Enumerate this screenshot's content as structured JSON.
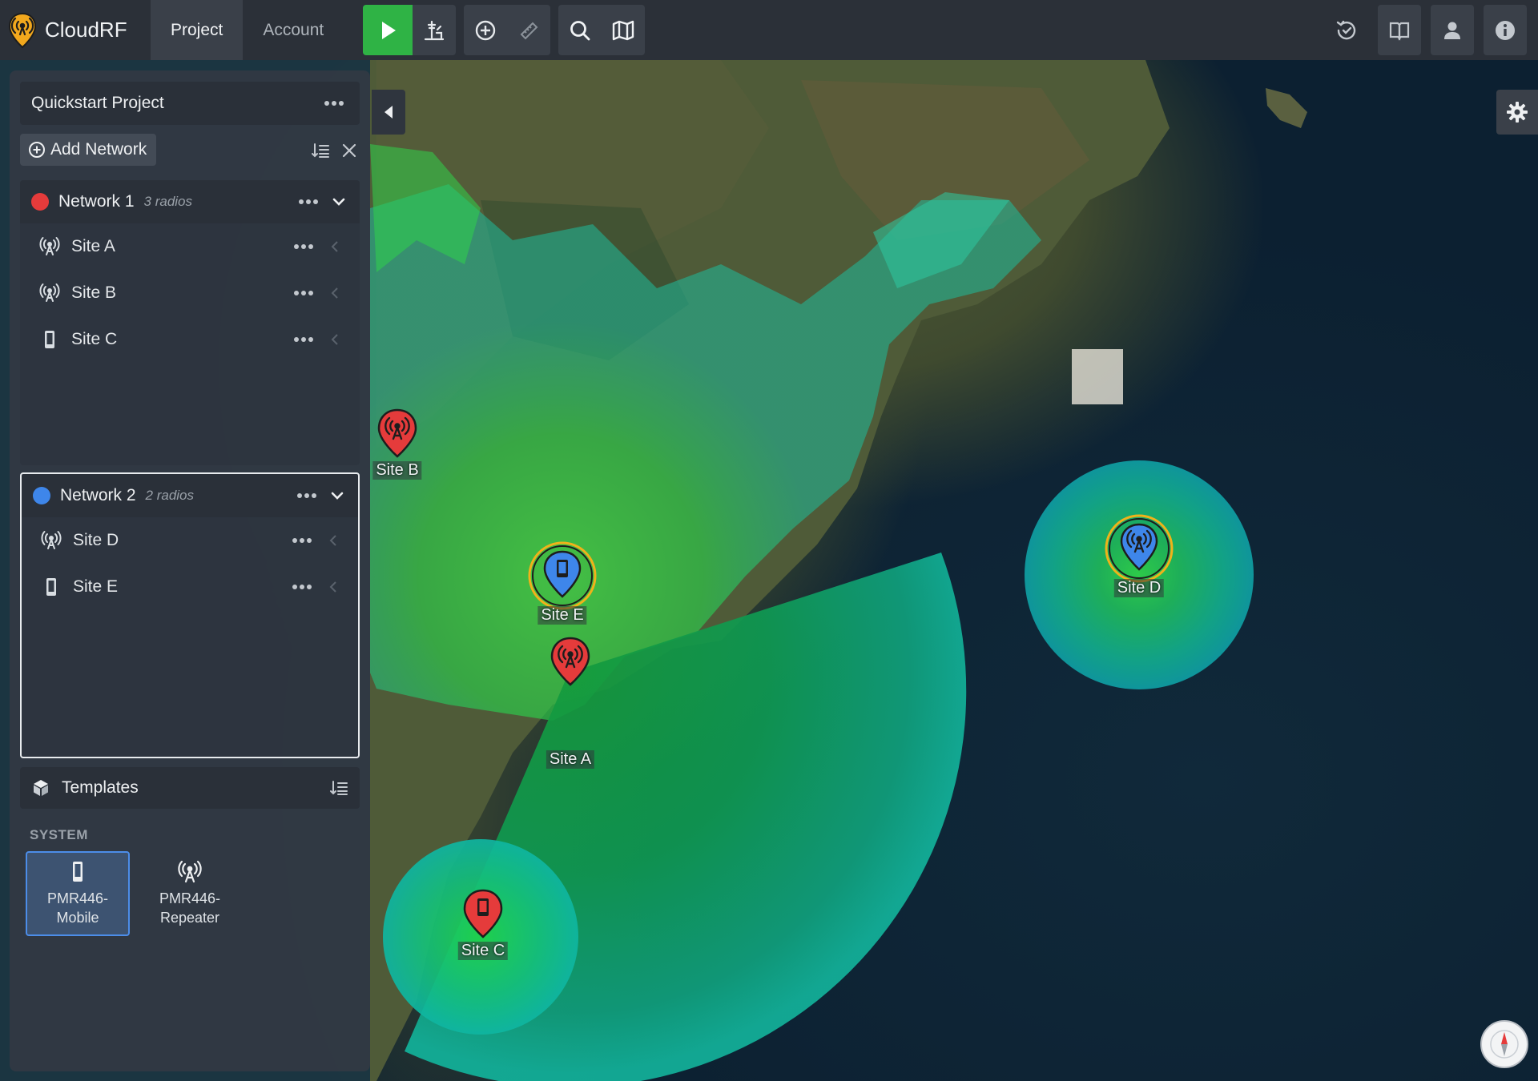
{
  "app": {
    "name": "CloudRF"
  },
  "nav": {
    "tabs": [
      {
        "label": "Project",
        "active": true
      },
      {
        "label": "Account",
        "active": false
      }
    ]
  },
  "project": {
    "title": "Quickstart Project",
    "add_network_label": "Add Network"
  },
  "networks": [
    {
      "name": "Network 1",
      "count": "3 radios",
      "color": "#e53b3b",
      "sites": [
        {
          "name": "Site A",
          "icon": "antenna-icon"
        },
        {
          "name": "Site B",
          "icon": "antenna-icon"
        },
        {
          "name": "Site C",
          "icon": "mobile-icon"
        }
      ]
    },
    {
      "name": "Network 2",
      "count": "2 radios",
      "color": "#3e86ea",
      "sites": [
        {
          "name": "Site D",
          "icon": "antenna-icon"
        },
        {
          "name": "Site E",
          "icon": "mobile-icon"
        }
      ]
    }
  ],
  "templates": {
    "title": "Templates",
    "section": "SYSTEM",
    "items": [
      {
        "line1": "PMR446-",
        "line2": "Mobile",
        "icon": "mobile-icon"
      },
      {
        "line1": "PMR446-",
        "line2": "Repeater",
        "icon": "antenna-icon"
      }
    ]
  },
  "map_markers": [
    {
      "label": "Site B",
      "network_color": "#e53b3b",
      "icon": "antenna-icon",
      "selected": false
    },
    {
      "label": "Site E",
      "network_color": "#3e86ea",
      "icon": "mobile-icon",
      "selected": true
    },
    {
      "label": "Site A",
      "network_color": "#e53b3b",
      "icon": "antenna-icon",
      "selected": false
    },
    {
      "label": "Site C",
      "network_color": "#e53b3b",
      "icon": "mobile-icon",
      "selected": false
    },
    {
      "label": "Site D",
      "network_color": "#3e86ea",
      "icon": "antenna-icon",
      "selected": true
    }
  ],
  "colors": {
    "run_button": "#2fb345",
    "coverage_strong": "#22d43a",
    "coverage_weak": "#11b89a",
    "selection_ring": "#f0b21a"
  }
}
